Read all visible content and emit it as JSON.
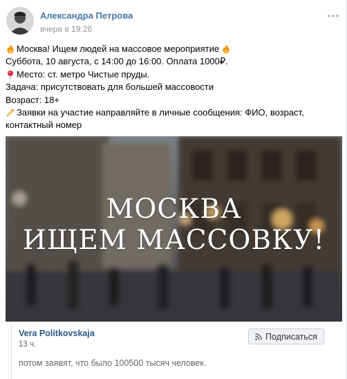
{
  "post": {
    "author": "Александра Петрова",
    "time": "вчера в 19:26",
    "lines": [
      "Москва! Ищем людей на массовое мероприятие",
      "Суббота, 10 августа, с 14:00 до 16:00. Оплата 1000₽.",
      "Место: ст. метро Чистые пруды.",
      "Задача: присутствовать для большей массовости",
      "Возраст: 18+",
      "Заявки на участие направляйте в личные сообщения: ФИО, возраст,",
      "контактный номер"
    ],
    "image": {
      "line1": "МОСКВА",
      "line2": "ИЩЕМ МАССОВКУ!"
    },
    "icons": {
      "fire": "fire-emoji-icon",
      "pin": "round-pushpin-emoji-icon",
      "pencil": "pencil-emoji-icon",
      "more": "more-icon"
    }
  },
  "comment": {
    "author": "Vera Politkovskaja",
    "time": "13 ч.",
    "text": "потом заявят, что было 100500 тысяч человек.",
    "subscribe_label": "Подписаться"
  },
  "colors": {
    "link": "#4a76a8",
    "comment_author": "#2a5885",
    "muted": "#939393"
  }
}
